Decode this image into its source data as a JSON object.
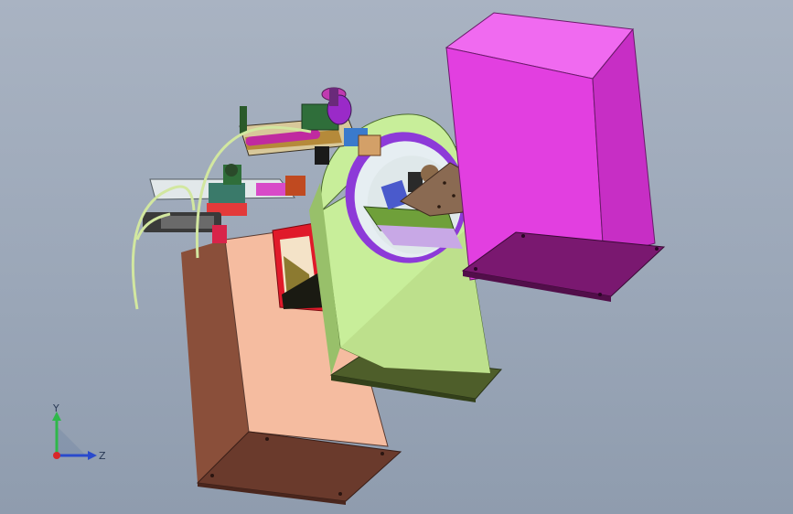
{
  "triad": {
    "y_label": "Y",
    "z_label": "Z"
  },
  "colors": {
    "background": "#9ba7b8",
    "magenta_block": "#e23fe0",
    "green_housing": "#c8ee9a",
    "salmon_column": "#f5bca0",
    "purple_ring": "#8d3ad8",
    "red_bracket": "#e01a2a",
    "tube": "#d2e7a0"
  }
}
